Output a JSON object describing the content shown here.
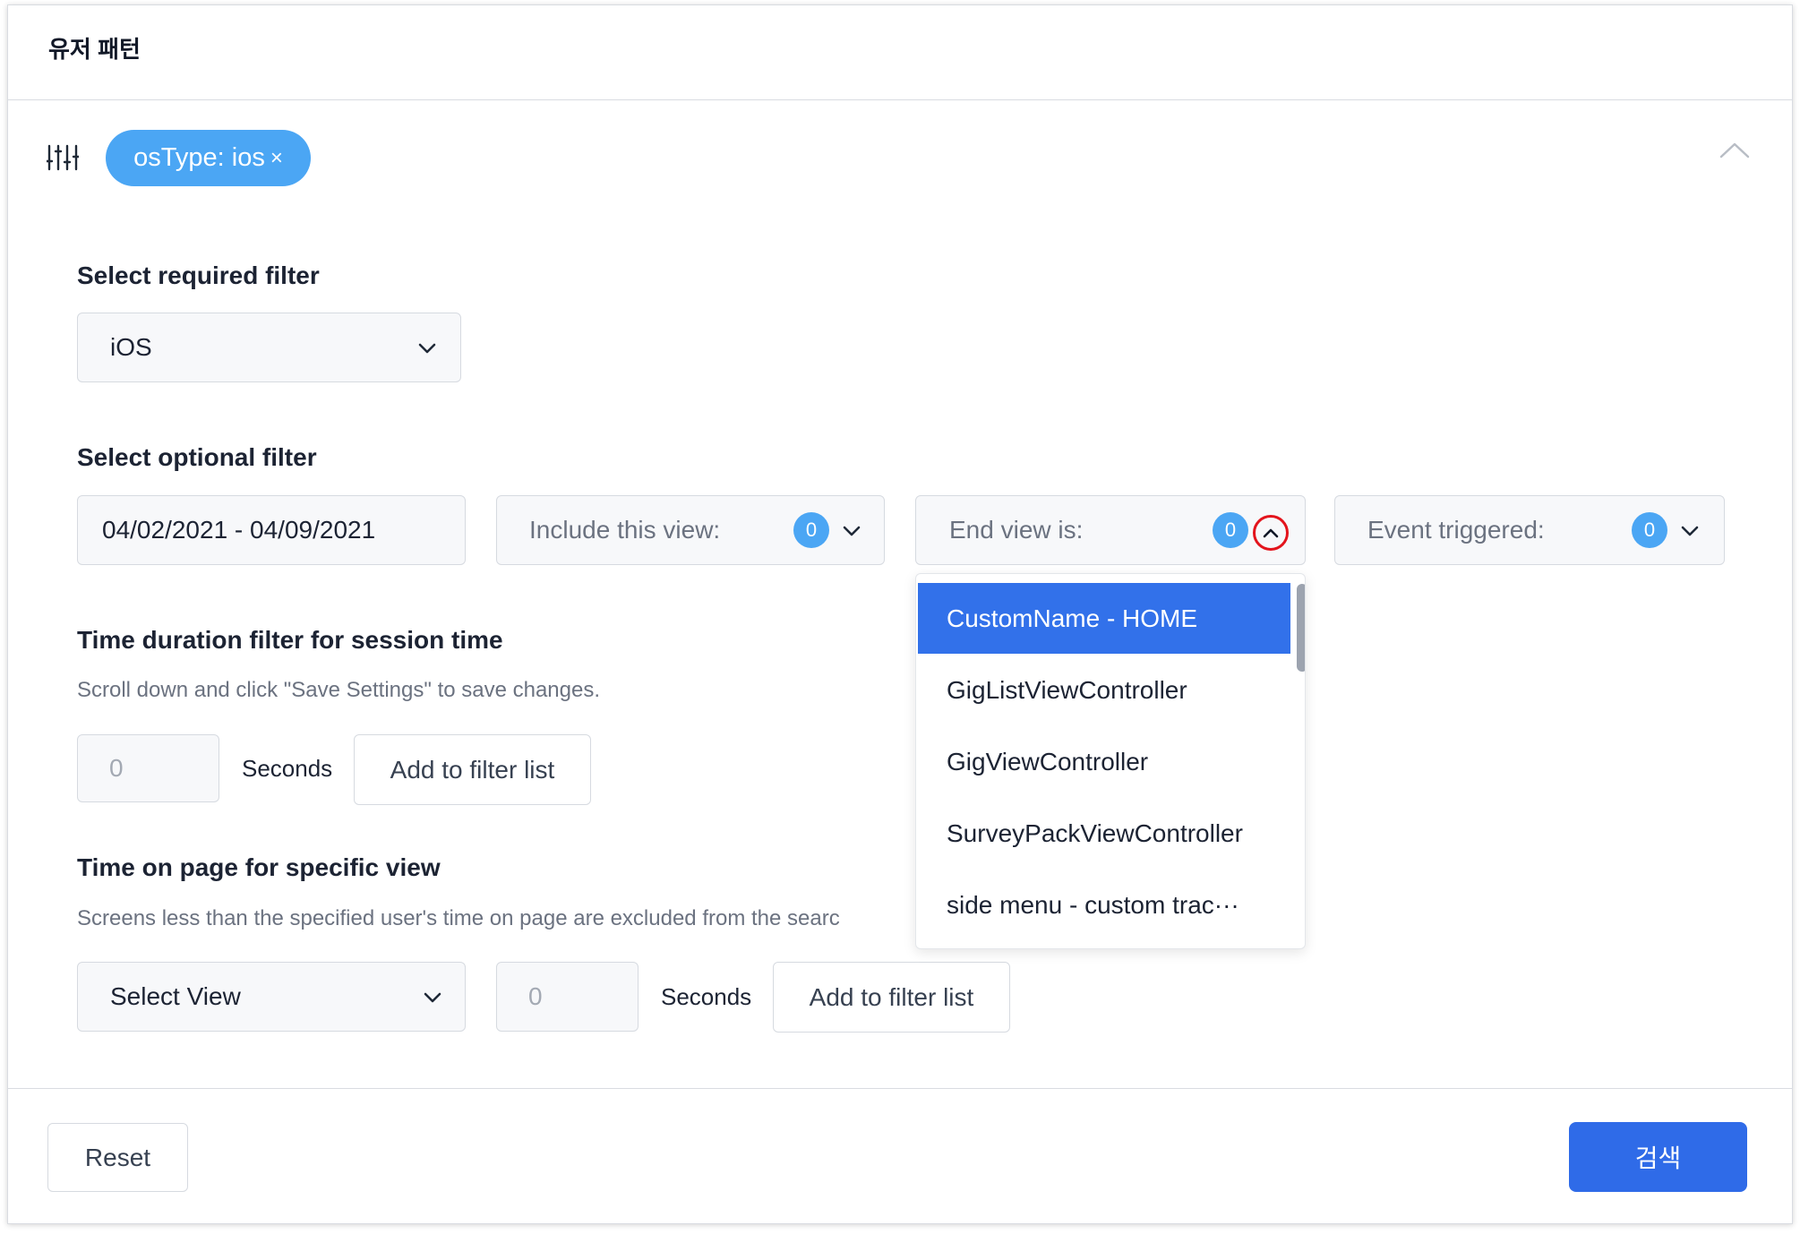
{
  "header": {
    "title": "유저 패턴"
  },
  "filter_bar": {
    "icon": "sliders-icon",
    "chips": [
      {
        "label": "osType: ios",
        "remove": "×"
      }
    ],
    "collapse_icon": "chevron-up-icon"
  },
  "required_filter": {
    "title": "Select required filter",
    "selected": "iOS"
  },
  "optional_filter": {
    "title": "Select optional filter",
    "date_range": "04/02/2021 - 04/09/2021",
    "include_view": {
      "label": "Include this view:",
      "count": "0"
    },
    "end_view": {
      "placeholder": "End view is:",
      "count": "0",
      "options": [
        "CustomName - HOME",
        "GigListViewController",
        "GigViewController",
        "SurveyPackViewController",
        "side menu - custom trac···"
      ],
      "highlighted_option": "CustomName - HOME"
    },
    "event_triggered": {
      "label": "Event triggered:",
      "count": "0"
    }
  },
  "session_duration": {
    "title": "Time duration filter for session time",
    "hint": "Scroll down and click \"Save Settings\" to save changes.",
    "input_placeholder": "0",
    "unit": "Seconds",
    "add_label": "Add to filter list"
  },
  "time_on_page": {
    "title": "Time on page for specific view",
    "hint": "Screens less than the specified user's time on page are excluded from the searc",
    "select_placeholder": "Select View",
    "input_placeholder": "0",
    "unit": "Seconds",
    "add_label": "Add to filter list"
  },
  "footer": {
    "reset_label": "Reset",
    "search_label": "검색"
  },
  "colors": {
    "primary": "#2F6BE8",
    "chip": "#4BA6F4",
    "badge": "#4BA6F4",
    "highlight": "#3271EA",
    "annotation_ring": "#E3141C"
  }
}
